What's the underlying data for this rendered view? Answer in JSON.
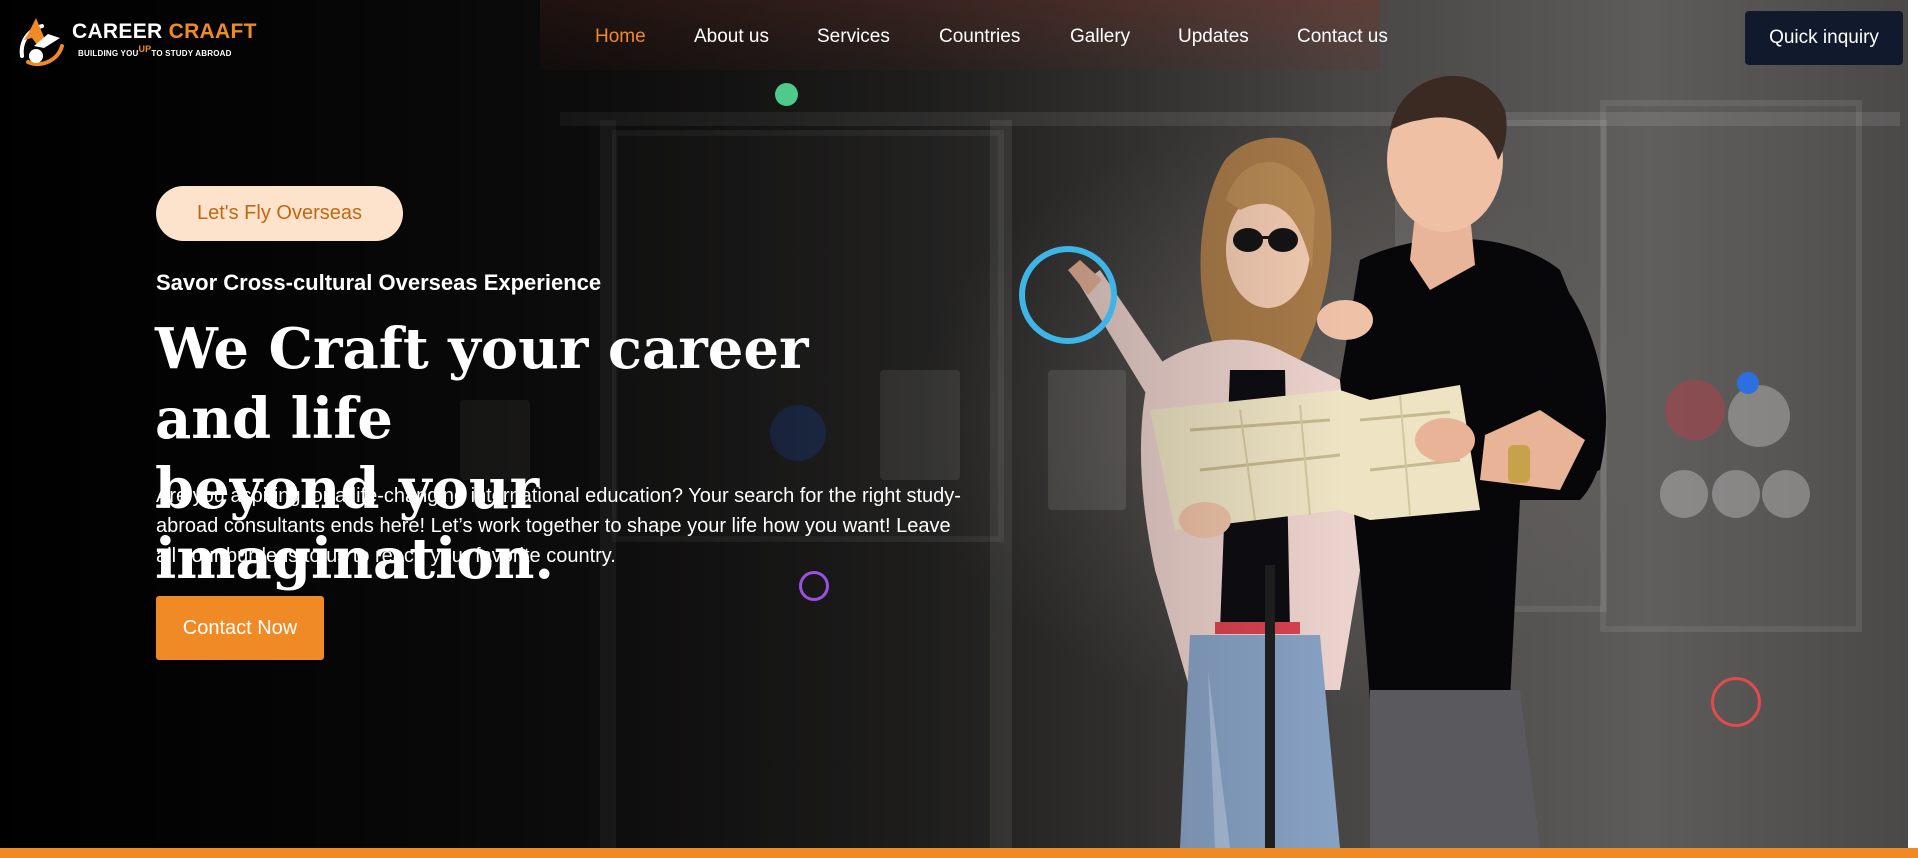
{
  "brand": {
    "name_part1": "CAREER",
    "name_part2": "CRAAFT",
    "tagline_before": "BUILDING YOU",
    "tagline_up": "UP",
    "tagline_after": "TO STUDY ABROAD",
    "accent_color": "#f08a24",
    "dark_color": "#111a2c"
  },
  "nav": {
    "items": [
      {
        "label": "Home",
        "active": true
      },
      {
        "label": "About us",
        "active": false
      },
      {
        "label": "Services",
        "active": false
      },
      {
        "label": "Countries",
        "active": false
      },
      {
        "label": "Gallery",
        "active": false
      },
      {
        "label": "Updates",
        "active": false
      },
      {
        "label": "Contact us",
        "active": false
      }
    ],
    "cta_label": "Quick inquiry"
  },
  "hero": {
    "pill_label": "Let's Fly Overseas",
    "subheading": "Savor Cross-cultural Overseas Experience",
    "headline_line1": "We Craft your career and life",
    "headline_line2": "beyond your imagination.",
    "description": "Are you aspiring for a life-changing international education? Your search for the right study-abroad consultants ends here! Let’s work together to shape your life how you want! Leave all your burdens to us to reach your favorite country.",
    "cta_label": "Contact Now",
    "image": "couple-with-map-photo"
  },
  "decorations": {
    "colors": [
      "#4ecb8a",
      "#3fb4e6",
      "#2e6fe0",
      "#9b51e0",
      "#e04b4b"
    ]
  }
}
